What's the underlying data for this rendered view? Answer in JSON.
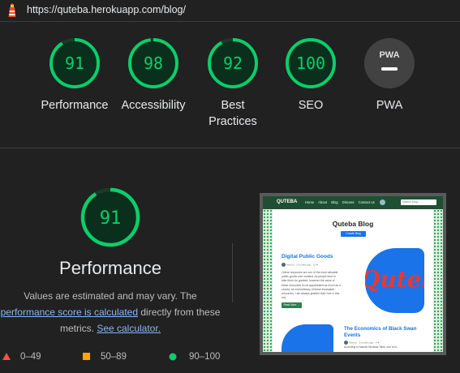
{
  "browser": {
    "url": "https://quteba.herokuapp.com/blog/"
  },
  "gauges": [
    {
      "score": "91",
      "label": "Performance",
      "color": "#0cce6b"
    },
    {
      "score": "98",
      "label": "Accessibility",
      "color": "#0cce6b"
    },
    {
      "score": "92",
      "label": "Best Practices",
      "color": "#0cce6b"
    },
    {
      "score": "100",
      "label": "SEO",
      "color": "#0cce6b"
    },
    {
      "score": "PWA",
      "label": "PWA",
      "color": "#9e9e9e"
    }
  ],
  "performance": {
    "score": "91",
    "title": "Performance",
    "desc_prefix": "Values are estimated and may vary. The",
    "link_score": "performance score is calculated",
    "desc_middle": "directly from these metrics.",
    "link_calc": "See calculator."
  },
  "legend": [
    {
      "shape": "triangle",
      "color": "#ff4e42",
      "range": "0–49"
    },
    {
      "shape": "square",
      "color": "#ffa400",
      "range": "50–89"
    },
    {
      "shape": "circle",
      "color": "#0cce6b",
      "range": "90–100"
    }
  ],
  "screenshot": {
    "brand": "QUTEBA",
    "nav_links": [
      "Home",
      "About",
      "Blog",
      "Discuss",
      "Contact us"
    ],
    "search_placeholder": "Search blog...",
    "title": "Quteba Blog",
    "create_button": "Create Blog",
    "post1_title": "Digital Public Goods",
    "post1_meta": "Ahmed · 2 months ago · 10 ♥",
    "post1_text": "Online resources are one of the most valuable public goods ever created. As people tend to take them for granted, however the value of these resources is not appreciated as much as it should. As a beneficiary of these invaluable resources, I am always grateful that I live in this era.",
    "read_more": "Read More →",
    "blob_text": "Quteb",
    "post2_title": "The Economics of Black Swan Events",
    "post2_meta": "Ahmed · 3 months ago · 8 ♥",
    "post2_text": "According to Nassim Nicholas Taleb, one of m..."
  }
}
